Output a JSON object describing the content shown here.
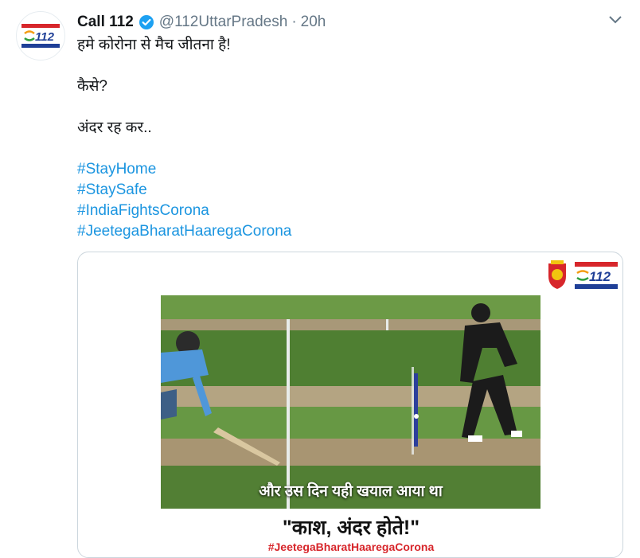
{
  "tweet": {
    "display_name": "Call 112",
    "handle": "@112UttarPradesh",
    "separator": "·",
    "time": "20h",
    "lines": [
      "हमे कोरोना से मैच जीतना है!",
      "कैसे?",
      "अंदर रह कर.."
    ],
    "hashtags": [
      "#StayHome",
      "#StaySafe",
      "#IndiaFightsCorona",
      "#JeetegaBharatHaaregaCorona"
    ]
  },
  "avatar": {
    "brand": "112",
    "subtext": "उत्तर प्रदेश"
  },
  "media": {
    "logo_text": "112",
    "logo_subtext": "उत्तर प्रदेश",
    "caption": "और उस दिन यही खयाल आया था",
    "quote": "\"काश, अंदर होते!\"",
    "hashtag": "#JeetegaBharatHaaregaCorona"
  },
  "colors": {
    "link": "#1b95e0",
    "verified": "#1da1f2",
    "muted": "#657786",
    "card_tag": "#d7262b"
  },
  "icons": {
    "verified": "verified-badge-icon",
    "caret": "chevron-down-icon",
    "emblem": "up-police-emblem-icon"
  }
}
